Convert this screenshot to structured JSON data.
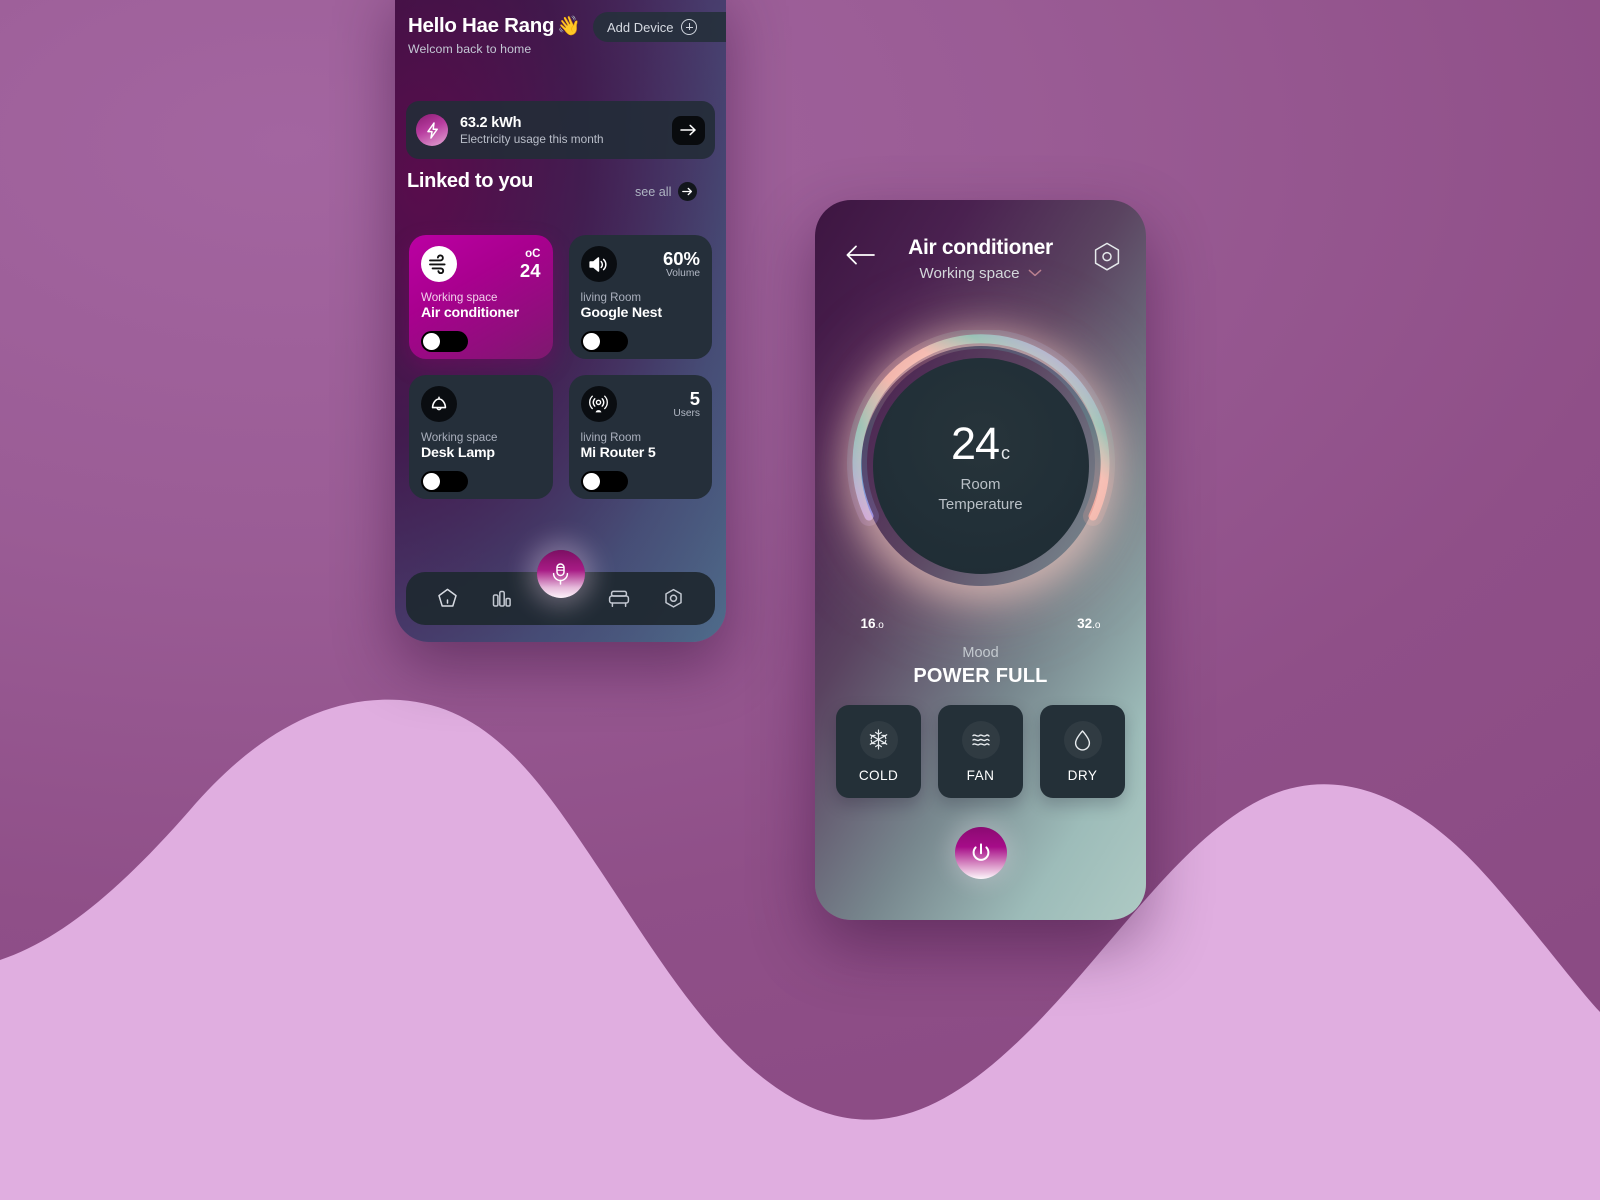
{
  "background": {
    "base_color": "#97588f",
    "wave_color": "#e0aee0"
  },
  "home_screen": {
    "greeting": "Hello Hae Rang",
    "greeting_emoji": "👋",
    "subgreeting": "Welcom back to home",
    "add_device_label": "Add Device",
    "add_device_icon": "plus-circle-icon",
    "energy": {
      "icon": "lightning-bolt-icon",
      "value": "63.2 kWh",
      "label": "Electricity usage this month",
      "arrow_icon": "arrow-right-icon"
    },
    "section_title": "Linked to you",
    "see_all_label": "see all",
    "see_all_icon": "arrow-right-circle-icon",
    "devices": [
      {
        "icon": "wind-icon",
        "metric_unit": "oC",
        "metric_value": "24",
        "metric_sub": "",
        "room": "Working space",
        "name": "Air conditioner",
        "accent": true,
        "accent_color": "#bb00a3",
        "toggle_on": false
      },
      {
        "icon": "speaker-icon",
        "metric_unit": "",
        "metric_value": "60%",
        "metric_sub": "Volume",
        "room": "living Room",
        "name": "Google Nest",
        "accent": false,
        "toggle_on": false
      },
      {
        "icon": "lamp-icon",
        "metric_unit": "",
        "metric_value": "",
        "metric_sub": "",
        "room": "Working space",
        "name": "Desk Lamp",
        "accent": false,
        "toggle_on": false
      },
      {
        "icon": "router-signal-icon",
        "metric_unit": "",
        "metric_value": "5",
        "metric_sub": "Users",
        "room": "living Room",
        "name": "Mi Router 5",
        "accent": false,
        "toggle_on": false
      }
    ],
    "nav": [
      {
        "icon": "home-icon",
        "name": "nav-home",
        "active": false
      },
      {
        "icon": "bar-chart-icon",
        "name": "nav-stats",
        "active": false
      },
      {
        "icon": "microphone-icon",
        "name": "nav-voice",
        "active": true
      },
      {
        "icon": "bed-icon",
        "name": "nav-rooms",
        "active": false
      },
      {
        "icon": "hexagon-settings-icon",
        "name": "nav-settings",
        "active": false
      }
    ]
  },
  "detail_screen": {
    "back_icon": "arrow-left-icon",
    "title": "Air conditioner",
    "room": "Working space",
    "room_chevron_icon": "chevron-down-icon",
    "settings_icon": "hexagon-camera-icon",
    "dial": {
      "temperature": "24",
      "unit": "c",
      "label_line1": "Room",
      "label_line2": "Temperature",
      "min": "16",
      "min_degree": ".o",
      "max": "32",
      "max_degree": ".o"
    },
    "mood_label": "Mood",
    "mood_value": "POWER FULL",
    "modes": [
      {
        "icon": "snowflake-icon",
        "label": "COLD"
      },
      {
        "icon": "waves-icon",
        "label": "FAN"
      },
      {
        "icon": "droplet-icon",
        "label": "DRY"
      }
    ],
    "power_icon": "power-icon"
  }
}
